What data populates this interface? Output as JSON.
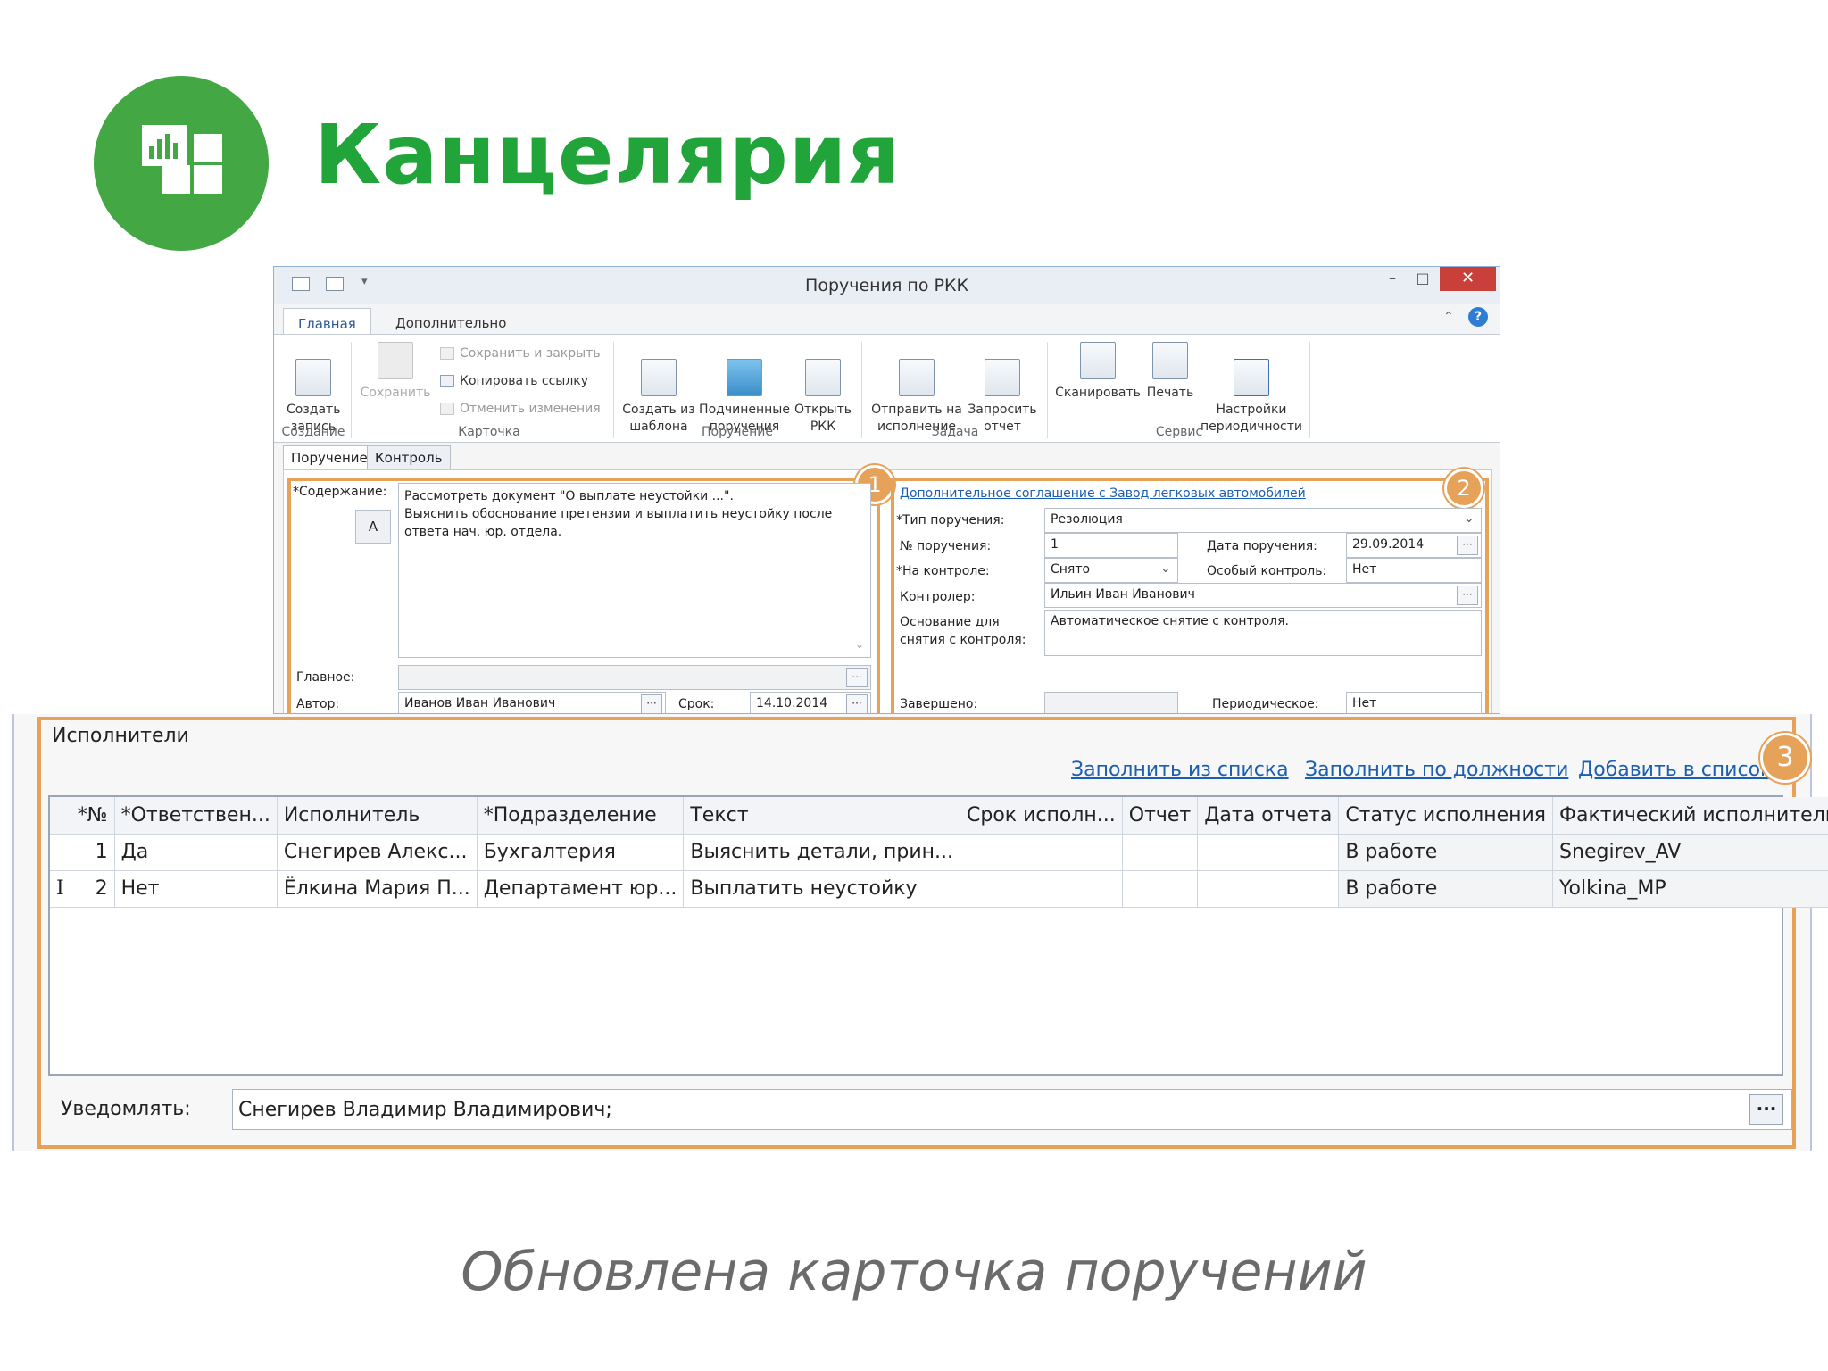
{
  "header": {
    "title": "Канцелярия",
    "logo_icon": "chart-grid-icon",
    "accent": "#43a844"
  },
  "window": {
    "title": "Поручения по РКК",
    "controls": {
      "minimize": "–",
      "maximize": "□",
      "close": "✕"
    },
    "ribbon_tabs": [
      "Главная",
      "Дополнительно"
    ],
    "ribbon": {
      "create_record": "Создать\nзапись",
      "save": "Сохранить",
      "save_close": "Сохранить и закрыть",
      "copy_link": "Копировать ссылку",
      "undo_changes": "Отменить изменения",
      "create_from_template": "Создать из\nшаблона",
      "sub_assignments": "Подчиненные\nпоручения",
      "open_rkk": "Открыть\nРКК",
      "send_execution": "Отправить на\nисполнение",
      "request_report": "Запросить\nотчет",
      "scan": "Сканировать",
      "print": "Печать",
      "periodicity": "Настройки\nпериодичности",
      "groups": {
        "create": "Создание",
        "card": "Карточка",
        "assignment": "Поручение",
        "task": "Задача",
        "service": "Сервис"
      }
    },
    "sub_tabs": [
      "Поручение",
      "Контроль"
    ],
    "left": {
      "content_label": "*Содержание:",
      "font_button": "A",
      "content_text": "Рассмотреть документ \"О выплате неустойки ...\".\nВыяснить обоснование претензии и выплатить неустойку после ответа нач. юр. отдела.",
      "main_label": "Главное:",
      "author_label": "Автор:",
      "author_value": "Иванов Иван Иванович",
      "due_label": "Срок:",
      "due_value": "14.10.2014",
      "badge": "1"
    },
    "right": {
      "link": "Дополнительное соглашение с Завод легковых автомобилей",
      "type_label": "*Тип поручения:",
      "type_value": "Резолюция",
      "num_label": "№ поручения:",
      "num_value": "1",
      "date_label": "Дата поручения:",
      "date_value": "29.09.2014",
      "control_label": "*На контроле:",
      "control_value": "Снято",
      "special_label": "Особый контроль:",
      "special_value": "Нет",
      "controller_label": "Контролер:",
      "controller_value": "Ильин Иван Иванович",
      "reason_label": "Основание для\nснятия с контроля:",
      "reason_value": "Автоматическое снятие с контроля.",
      "completed_label": "Завершено:",
      "periodic_label": "Периодическое:",
      "periodic_value": "Нет",
      "badge": "2"
    }
  },
  "executors": {
    "title": "Исполнители",
    "links": [
      "Заполнить из списка",
      "Заполнить по должности",
      "Добавить в список"
    ],
    "badge": "3",
    "columns": [
      "*№",
      "*Ответствен...",
      "Исполнитель",
      "*Подразделение",
      "Текст",
      "Срок исполн...",
      "Отчет",
      "Дата отчета",
      "Статус исполнения",
      "Фактический исполнитель"
    ],
    "rows": [
      [
        "1",
        "Да",
        "Снегирев Алекс...",
        "Бухгалтерия",
        "Выяснить детали, прин...",
        "",
        "",
        "",
        "В работе",
        "Snegirev_AV"
      ],
      [
        "2",
        "Нет",
        "Ёлкина Мария П...",
        "Департамент юр...",
        "Выплатить неустойку",
        "",
        "",
        "",
        "В работе",
        "Yolkina_MP"
      ]
    ],
    "notify_label": "Уведомлять:",
    "notify_value": "Снегирев Владимир Владимирович;",
    "ellipsis": "···"
  },
  "caption": "Обновлена карточка поручений"
}
